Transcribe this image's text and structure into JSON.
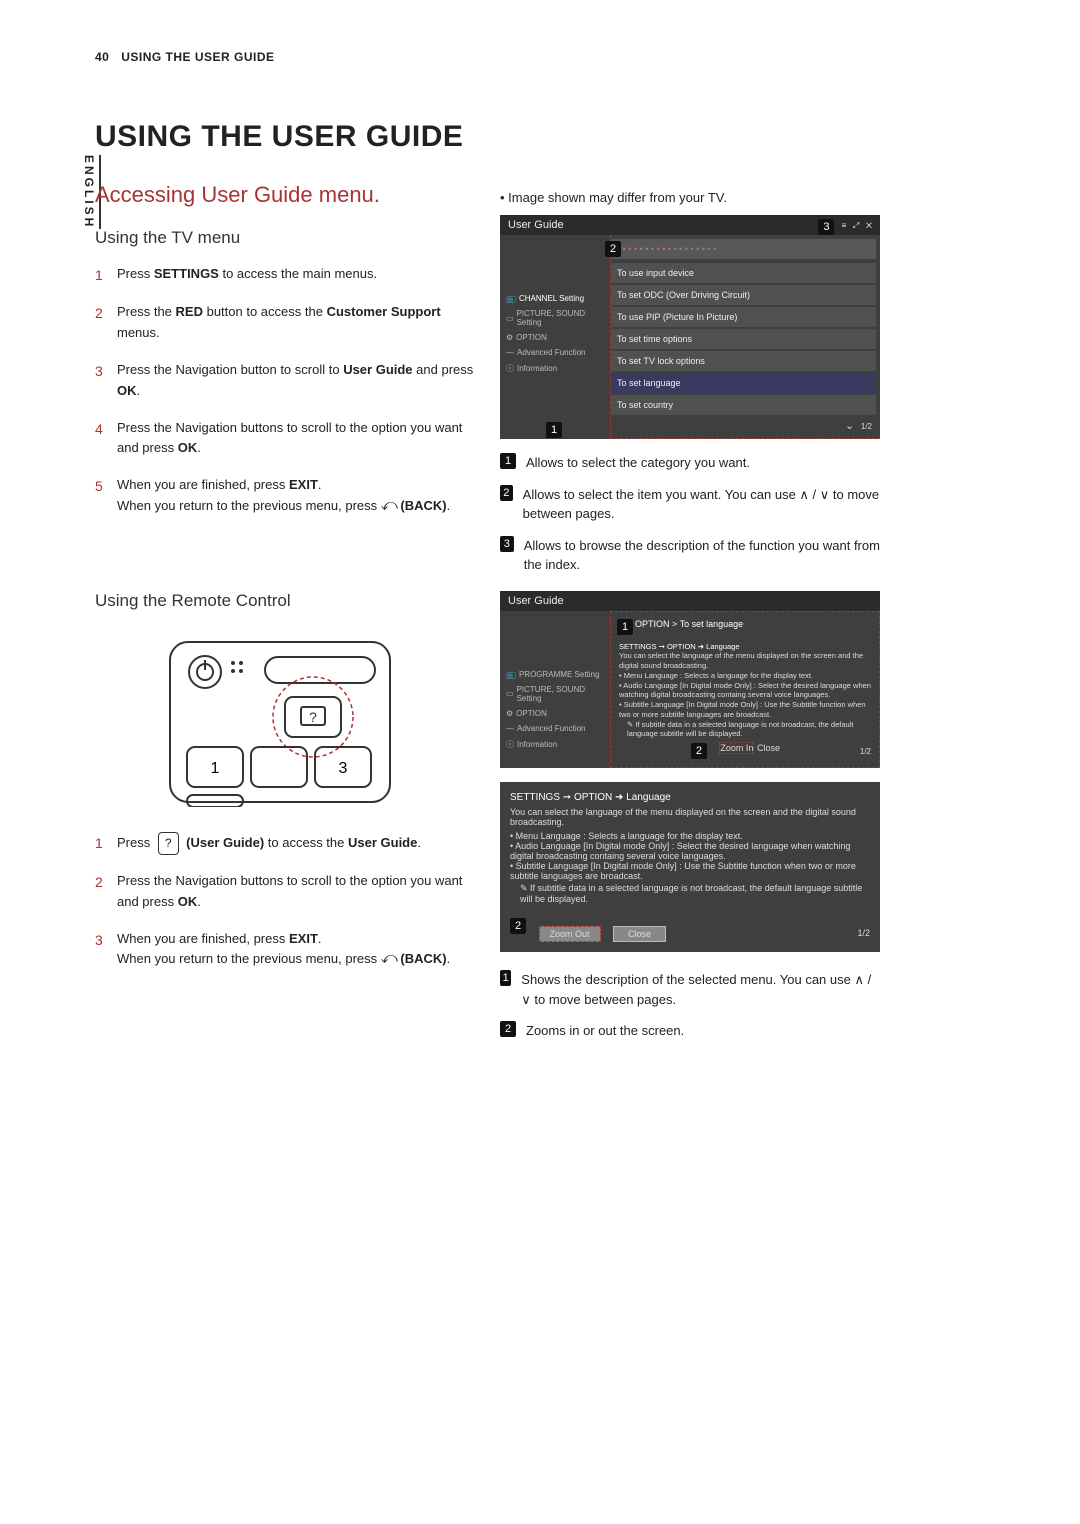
{
  "header": {
    "page_number": "40",
    "section": "USING THE USER GUIDE"
  },
  "language_tab": "ENGLISH",
  "h1": "USING THE USER GUIDE",
  "h2": "Accessing User Guide menu.",
  "tv_menu": {
    "heading": "Using the TV menu",
    "steps": [
      "Press SETTINGS to access the main menus.",
      "Press the RED button to access the Customer Support menus.",
      "Press the Navigation button to scroll to User Guide and press OK.",
      "Press the Navigation buttons to scroll to the option you want and press OK.",
      "When you are finished, press EXIT. When you return to the previous menu, press  (BACK)."
    ]
  },
  "remote": {
    "heading": "Using the Remote Control",
    "steps": [
      "Press  (User Guide) to access the User Guide.",
      "Press the Navigation buttons to scroll to the option you want and press OK.",
      "When you are finished, press EXIT. When you return to the previous menu, press  (BACK)."
    ]
  },
  "note": "Image shown may differ from your TV.",
  "shot1": {
    "title": "User Guide",
    "sidebar": [
      "CHANNEL Setting",
      "PICTURE, SOUND Setting",
      "OPTION",
      "Advanced Function",
      "Information"
    ],
    "items": [
      "To use input device",
      "To set ODC (Over Driving Circuit)",
      "To use PIP (Picture In Picture)",
      "To set time options",
      "To set TV lock options",
      "To set language",
      "To set country"
    ],
    "page": "1/2"
  },
  "callouts1": [
    "Allows to select the category you want.",
    "Allows to select the item you want. You can use ∧ / ∨ to move between pages.",
    "Allows to browse the description of the function you want from the index."
  ],
  "shot2": {
    "title": "User Guide",
    "breadcrumb": "OPTION > To set language",
    "sidebar": [
      "PROGRAMME Setting",
      "PICTURE, SOUND Setting",
      "OPTION",
      "Advanced Function",
      "Information"
    ],
    "desc_heading": "SETTINGS ➞ OPTION ➜ Language",
    "desc_intro": "You can select the language of the menu displayed on the screen and the digital sound broadcasting.",
    "bullets": [
      "Menu Language : Selects a language for the display text.",
      "Audio Language [In Digital mode Only] : Select the desired language when watching digital broadcasting containg several voice languages.",
      "Subtitle Language [In Digital mode Only] : Use the Subtitle function when two or more subtitle languages are broadcast.",
      "✎ If subtitle data in a selected language is not broadcast, the default language subtitle will be displayed."
    ],
    "zoom_in": "Zoom In",
    "close": "Close",
    "page": "1/2"
  },
  "shot3": {
    "desc_heading": "SETTINGS ➞ OPTION ➜ Language",
    "desc_intro": "You can select the language of the menu displayed on the screen and the digital sound broadcasting.",
    "bullets": [
      "Menu Language : Selects a language for the display text.",
      "Audio Language [In Digital mode Only] : Select the desired language when watching digital broadcasting containg several voice languages.",
      "Subtitle Language [In Digital mode Only] : Use the Subtitle function when two or more subtitle languages are broadcast.",
      "✎ If subtitle data in a selected language is not broadcast, the default language subtitle will be displayed."
    ],
    "zoom_out": "Zoom Out",
    "close": "Close",
    "page": "1/2"
  },
  "callouts2": [
    "Shows the description of the selected menu. You can use ∧ / ∨ to move between pages.",
    "Zooms in or out the screen."
  ]
}
